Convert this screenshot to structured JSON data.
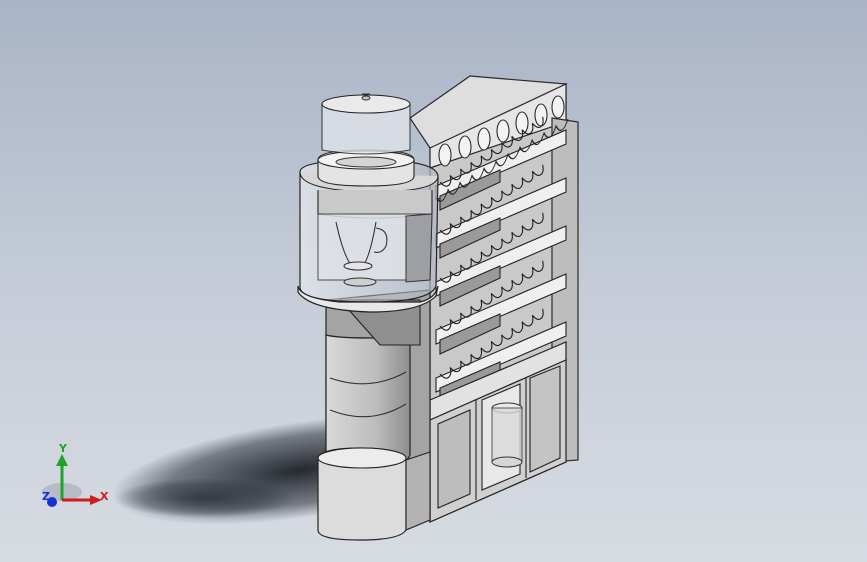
{
  "viewport": {
    "background_top": "#a9b4c6",
    "background_bottom": "#d7dbe2"
  },
  "triad": {
    "x_label": "X",
    "y_label": "Y",
    "z_label": "Z",
    "x_color": "#d11a1a",
    "y_color": "#1fa32b",
    "z_color": "#1a2fd1"
  },
  "model": {
    "shelf_rows": 6,
    "top_holes": 7
  }
}
